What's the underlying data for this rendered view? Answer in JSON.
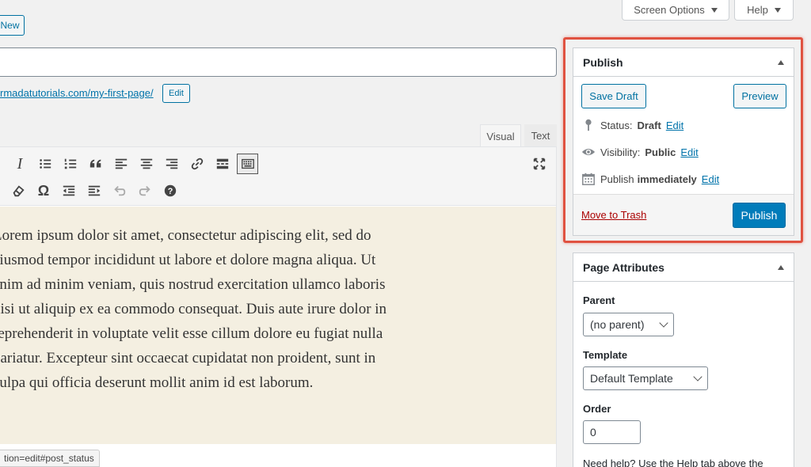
{
  "header": {
    "add_new_label": "New",
    "screen_options_label": "Screen Options",
    "help_label": "Help"
  },
  "title_input": {
    "value": "",
    "placeholder": ""
  },
  "permalink": {
    "url_text": "rmadatutorials.com/my-first-page/",
    "edit_label": "Edit"
  },
  "editor": {
    "tabs": {
      "visual": "Visual",
      "text": "Text"
    },
    "content_lines": [
      "Lorem ipsum dolor sit amet, consectetur adipiscing elit, sed do",
      "eiusmod tempor incididunt ut labore et dolore magna aliqua. Ut",
      "enim ad minim veniam, quis nostrud exercitation ullamco laboris",
      "nisi ut aliquip ex ea commodo consequat. Duis aute irure dolor in",
      "reprehenderit in voluptate velit esse cillum dolore eu fugiat nulla",
      "pariatur. Excepteur sint occaecat cupidatat non proident, sunt in",
      "culpa qui officia deserunt mollit anim id est laborum."
    ],
    "status_url": "tion=edit#post_status"
  },
  "publish_box": {
    "title": "Publish",
    "save_draft_label": "Save Draft",
    "preview_label": "Preview",
    "status_label": "Status:",
    "status_value": "Draft",
    "status_edit": "Edit",
    "visibility_label": "Visibility:",
    "visibility_value": "Public",
    "visibility_edit": "Edit",
    "publish_time_label": "Publish",
    "publish_time_value": "immediately",
    "publish_time_edit": "Edit",
    "trash_label": "Move to Trash",
    "publish_label": "Publish",
    "highlight_color": "#e05241"
  },
  "page_attributes": {
    "title": "Page Attributes",
    "parent_label": "Parent",
    "parent_value": "(no parent)",
    "template_label": "Template",
    "template_value": "Default Template",
    "order_label": "Order",
    "order_value": "0",
    "help_text": "Need help? Use the Help tab above the"
  },
  "colors": {
    "primary": "#0073aa",
    "editor_bg": "#f4efe1",
    "trash_red": "#a00"
  }
}
